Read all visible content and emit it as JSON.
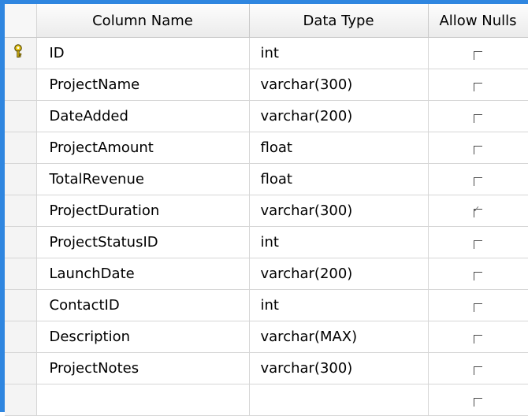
{
  "headers": {
    "column_name": "Column Name",
    "data_type": "Data Type",
    "allow_nulls": "Allow Nulls"
  },
  "rows": [
    {
      "name": "ID",
      "type": "int",
      "allow_nulls": false,
      "primary_key": true
    },
    {
      "name": "ProjectName",
      "type": "varchar(300)",
      "allow_nulls": false
    },
    {
      "name": "DateAdded",
      "type": "varchar(200)",
      "allow_nulls": false
    },
    {
      "name": "ProjectAmount",
      "type": "float",
      "allow_nulls": false
    },
    {
      "name": "TotalRevenue",
      "type": "float",
      "allow_nulls": false
    },
    {
      "name": "ProjectDuration",
      "type": "varchar(300)",
      "allow_nulls": true
    },
    {
      "name": "ProjectStatusID",
      "type": "int",
      "allow_nulls": false
    },
    {
      "name": "LaunchDate",
      "type": "varchar(200)",
      "allow_nulls": false
    },
    {
      "name": "ContactID",
      "type": "int",
      "allow_nulls": false
    },
    {
      "name": "Description",
      "type": "varchar(MAX)",
      "allow_nulls": false
    },
    {
      "name": "ProjectNotes",
      "type": "varchar(300)",
      "allow_nulls": false
    },
    {
      "name": "",
      "type": "",
      "allow_nulls": false
    }
  ],
  "icons": {
    "primary_key": "key-icon",
    "allow_nulls_checkbox": "checkbox-icon"
  },
  "colors": {
    "frame": "#2f86e0",
    "key": "#e6c619"
  }
}
